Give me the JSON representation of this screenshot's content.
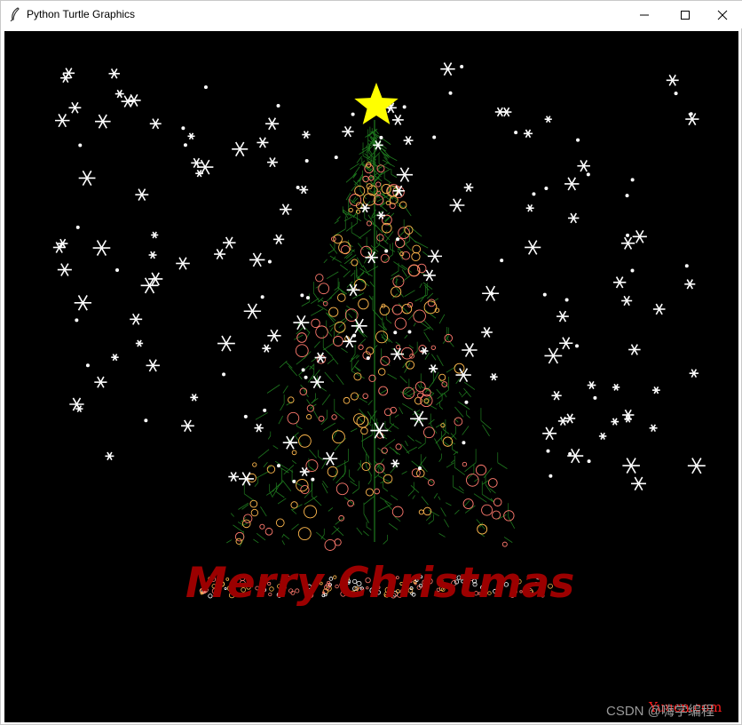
{
  "window": {
    "title": "Python Turtle Graphics",
    "controls": {
      "minimize": "minimize-icon",
      "maximize": "maximize-icon",
      "close": "close-icon"
    }
  },
  "canvas": {
    "background": "#000000",
    "greeting": "Merry Christmas",
    "greeting_color": "#9b0000",
    "star_color": "#ffff00",
    "tree_color": "#1f7a1f",
    "ornament_colors": [
      "#ff7a6e",
      "#ffb84d",
      "#ffffff"
    ],
    "snow_color": "#ffffff"
  },
  "watermarks": {
    "site": "Yuucn.com",
    "csdn": "CSDN @嗨学编程"
  }
}
